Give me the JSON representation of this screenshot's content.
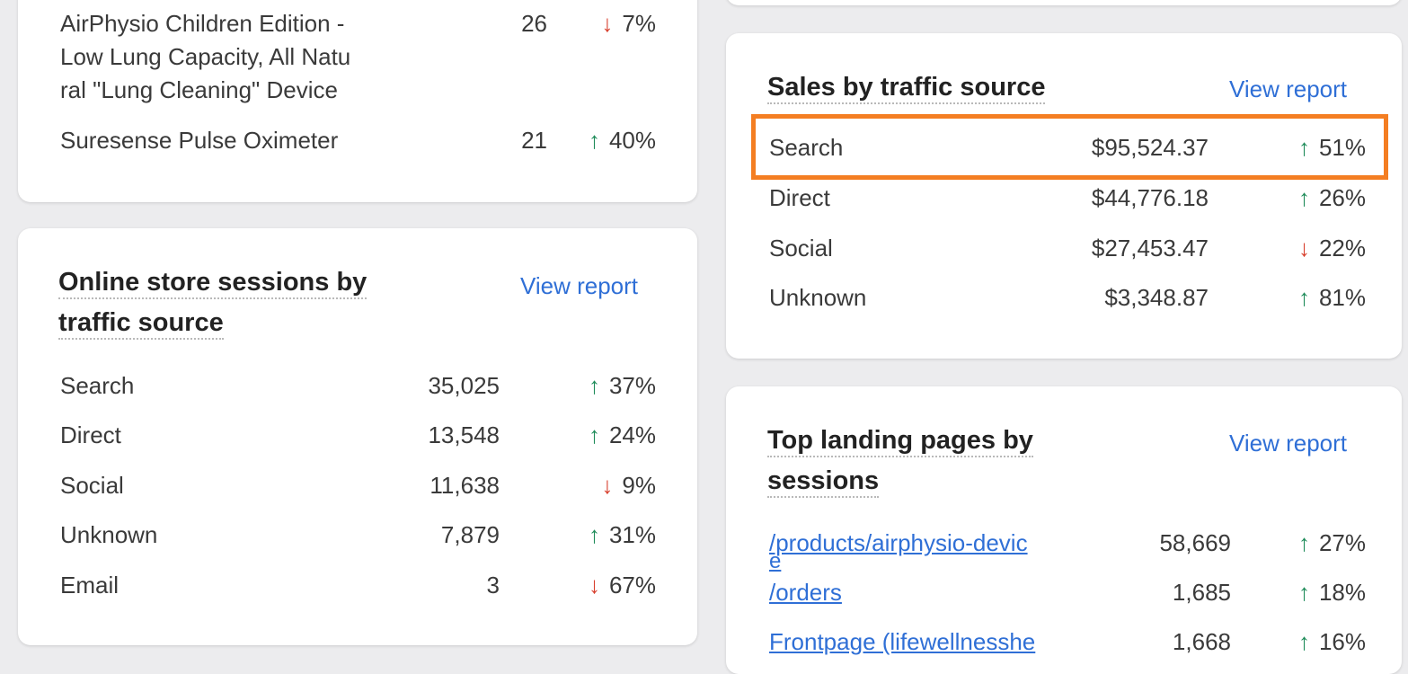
{
  "top_products": {
    "rows": [
      {
        "name": "AirPhysio Children Edition - Low Lung Capacity, All Natu ral \"Lung Cleaning\" Device",
        "line1": "AirPhysio Children Edition -",
        "line2": "Low Lung Capacity, All Natu",
        "line3": "ral \"Lung Cleaning\" Device",
        "count": "26",
        "change": "7%",
        "direction": "down"
      },
      {
        "name": "Suresense Pulse Oximeter",
        "count": "21",
        "change": "40%",
        "direction": "up"
      }
    ]
  },
  "sessions_by_source": {
    "title_line1": "Online store sessions by",
    "title_line2": "traffic source",
    "view_report": "View report",
    "rows": [
      {
        "source": "Search",
        "value": "35,025",
        "change": "37%",
        "direction": "up"
      },
      {
        "source": "Direct",
        "value": "13,548",
        "change": "24%",
        "direction": "up"
      },
      {
        "source": "Social",
        "value": "11,638",
        "change": "9%",
        "direction": "down"
      },
      {
        "source": "Unknown",
        "value": "7,879",
        "change": "31%",
        "direction": "up"
      },
      {
        "source": "Email",
        "value": "3",
        "change": "67%",
        "direction": "down"
      }
    ]
  },
  "sales_by_source": {
    "title": "Sales by traffic source",
    "view_report": "View report",
    "rows": [
      {
        "source": "Search",
        "value": "$95,524.37",
        "change": "51%",
        "direction": "up",
        "highlighted": true
      },
      {
        "source": "Direct",
        "value": "$44,776.18",
        "change": "26%",
        "direction": "up"
      },
      {
        "source": "Social",
        "value": "$27,453.47",
        "change": "22%",
        "direction": "down"
      },
      {
        "source": "Unknown",
        "value": "$3,348.87",
        "change": "81%",
        "direction": "up"
      }
    ]
  },
  "landing_pages": {
    "title_line1": "Top landing pages by",
    "title_line2": "sessions",
    "view_report": "View report",
    "rows": [
      {
        "page": "/products/airphysio-devic",
        "page_wrap": "e",
        "value": "58,669",
        "change": "27%",
        "direction": "up"
      },
      {
        "page": "/orders",
        "value": "1,685",
        "change": "18%",
        "direction": "up"
      },
      {
        "page": "Frontpage (lifewellnesshe",
        "value": "1,668",
        "change": "16%",
        "direction": "up"
      }
    ]
  },
  "icons": {
    "up": "arrow-up-icon",
    "down": "arrow-down-icon"
  },
  "colors": {
    "up": "#1f8c5a",
    "down": "#d8412f",
    "link": "#2f6fd6",
    "highlight": "#f47e22"
  }
}
